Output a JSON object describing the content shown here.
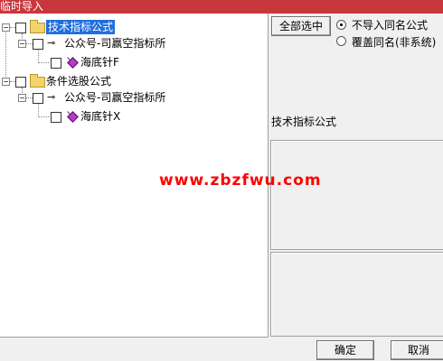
{
  "window": {
    "title": "临时导入"
  },
  "tree": {
    "nodes": [
      {
        "label": "技术指标公式",
        "selected": true
      },
      {
        "label": "公众号-司赢空指标所"
      },
      {
        "label": "海底针F"
      },
      {
        "label": "条件选股公式"
      },
      {
        "label": "公众号-司赢空指标所"
      },
      {
        "label": "海底针X"
      }
    ]
  },
  "options": {
    "select_all_label": "全部选中",
    "radio_no_import_label": "不导入同名公式",
    "radio_overwrite_label": "覆盖同名(非系统)",
    "selected_radio": "no_import"
  },
  "detail": {
    "category_label": "技术指标公式"
  },
  "watermark": "www.zbzfwu.com",
  "footer": {
    "ok_label": "确定",
    "cancel_label": "取消"
  },
  "colors": {
    "titlebar": "#c8373c",
    "selection": "#1f6ee0",
    "watermark": "#ff0000"
  }
}
